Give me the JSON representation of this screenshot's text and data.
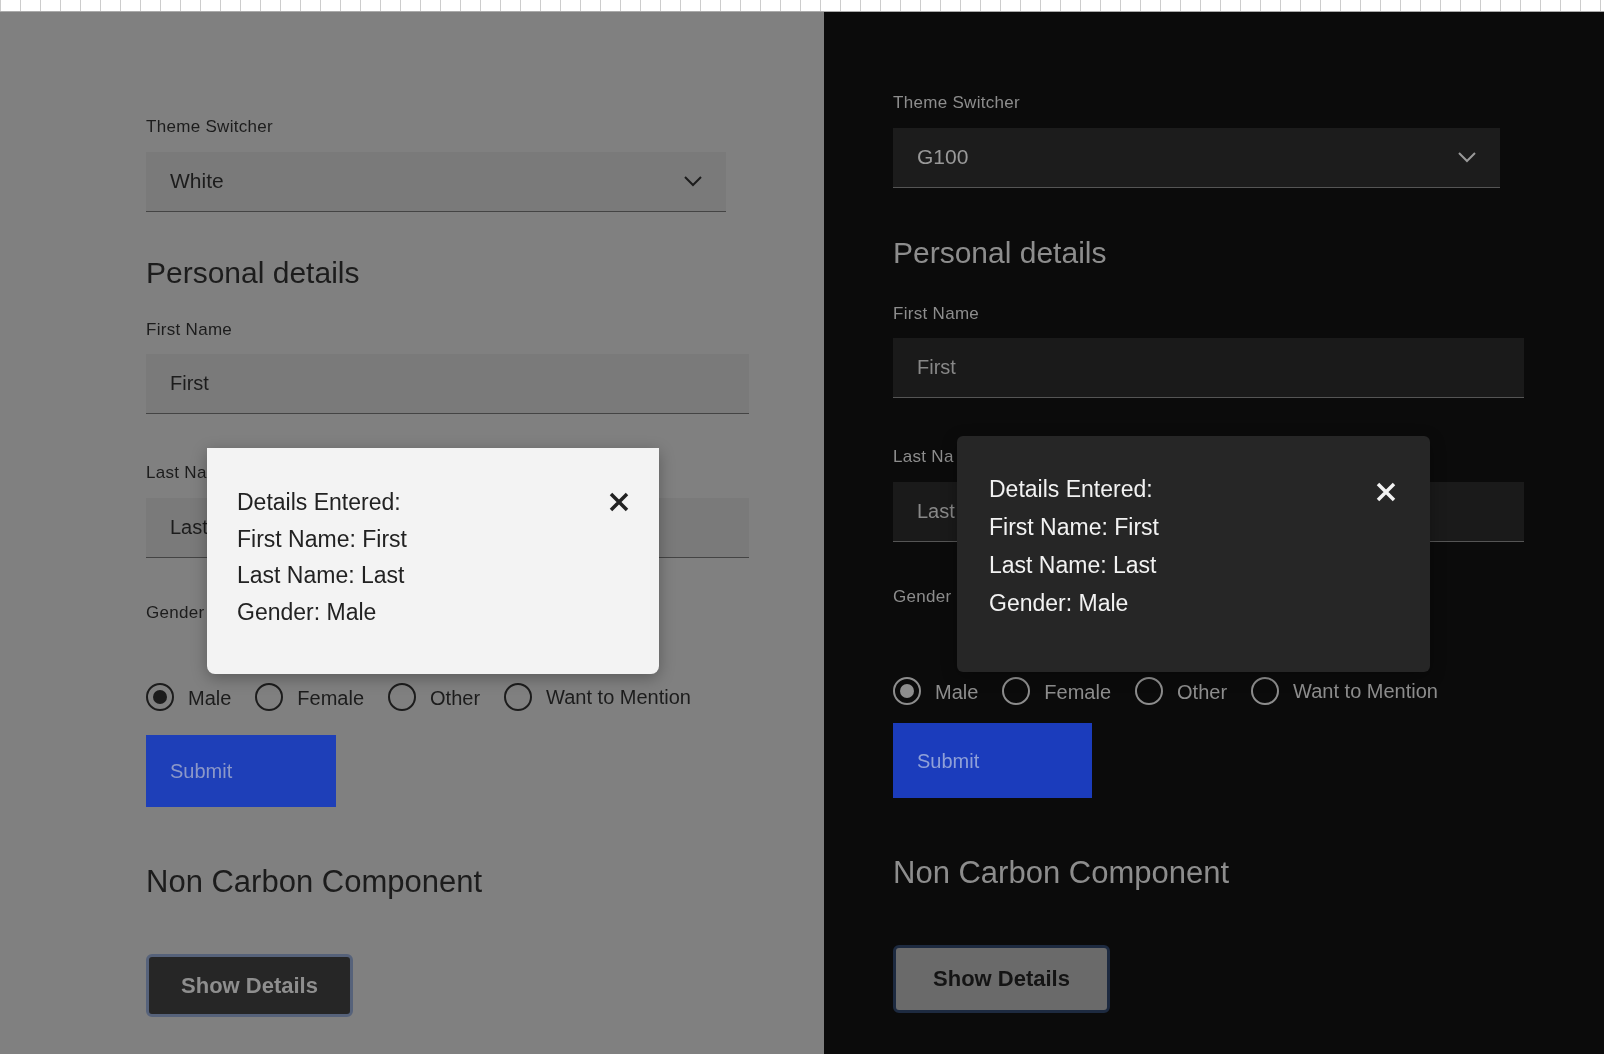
{
  "panels": [
    {
      "kind": "light",
      "switcher": {
        "label": "Theme Switcher",
        "value": "White"
      },
      "heading": "Personal details",
      "fields": [
        {
          "label": "First Name",
          "value": "First"
        },
        {
          "label": "Last Na",
          "value": "Last"
        }
      ],
      "gender_label": "Gender",
      "radios": [
        {
          "label": "Male",
          "selected": true
        },
        {
          "label": "Female",
          "selected": false
        },
        {
          "label": "Other",
          "selected": false
        },
        {
          "label": "Want to Mention",
          "selected": false
        }
      ],
      "submit": "Submit",
      "section_heading": "Non Carbon Component",
      "show_button": "Show Details",
      "modal": {
        "lines": [
          "Details Entered:",
          "First Name: First",
          "Last Name: Last",
          "Gender: Male"
        ]
      }
    },
    {
      "kind": "dark",
      "switcher": {
        "label": "Theme Switcher",
        "value": "G100"
      },
      "heading": "Personal details",
      "fields": [
        {
          "label": "First Name",
          "value": "First"
        },
        {
          "label": "Last Na",
          "value": "Last"
        }
      ],
      "gender_label": "Gender",
      "radios": [
        {
          "label": "Male",
          "selected": true
        },
        {
          "label": "Female",
          "selected": false
        },
        {
          "label": "Other",
          "selected": false
        },
        {
          "label": "Want to Mention",
          "selected": false
        }
      ],
      "submit": "Submit",
      "section_heading": "Non Carbon Component",
      "show_button": "Show Details",
      "modal": {
        "lines": [
          "Details Entered:",
          "First Name: First",
          "Last Name: Last",
          "Gender: Male"
        ]
      }
    }
  ]
}
